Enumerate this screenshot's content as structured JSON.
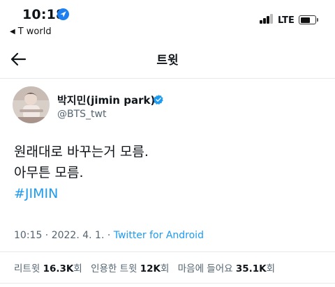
{
  "status_bar": {
    "time": "10:18",
    "back_app": "T world",
    "network": "LTE",
    "icons": [
      "location-arrow-icon",
      "signal-bars-icon",
      "battery-icon"
    ]
  },
  "nav": {
    "title": "트윗",
    "back_icon": "back-arrow-icon"
  },
  "author": {
    "display_name": "박지민(jimin park)",
    "handle": "@BTS_twt",
    "verified": true
  },
  "tweet": {
    "lines": [
      "원래대로 바꾸는거 모름.",
      "아무튼 모름."
    ],
    "hashtag": "#JIMIN",
    "timestamp": "10:15 · 2022. 4. 1. · ",
    "source": "Twitter for Android"
  },
  "stats": {
    "retweets_label": "리트윗",
    "retweets_value": "16.3K",
    "retweets_unit": "회",
    "quotes_label": "인용한 트윗",
    "quotes_value": "12K",
    "quotes_unit": "회",
    "likes_label": "마음에 들어요",
    "likes_value": "35.1K",
    "likes_unit": "회"
  },
  "colors": {
    "accent": "#1d9bf0",
    "text": "#0f1419",
    "secondary": "#536471",
    "divider": "#e6e9ec"
  }
}
